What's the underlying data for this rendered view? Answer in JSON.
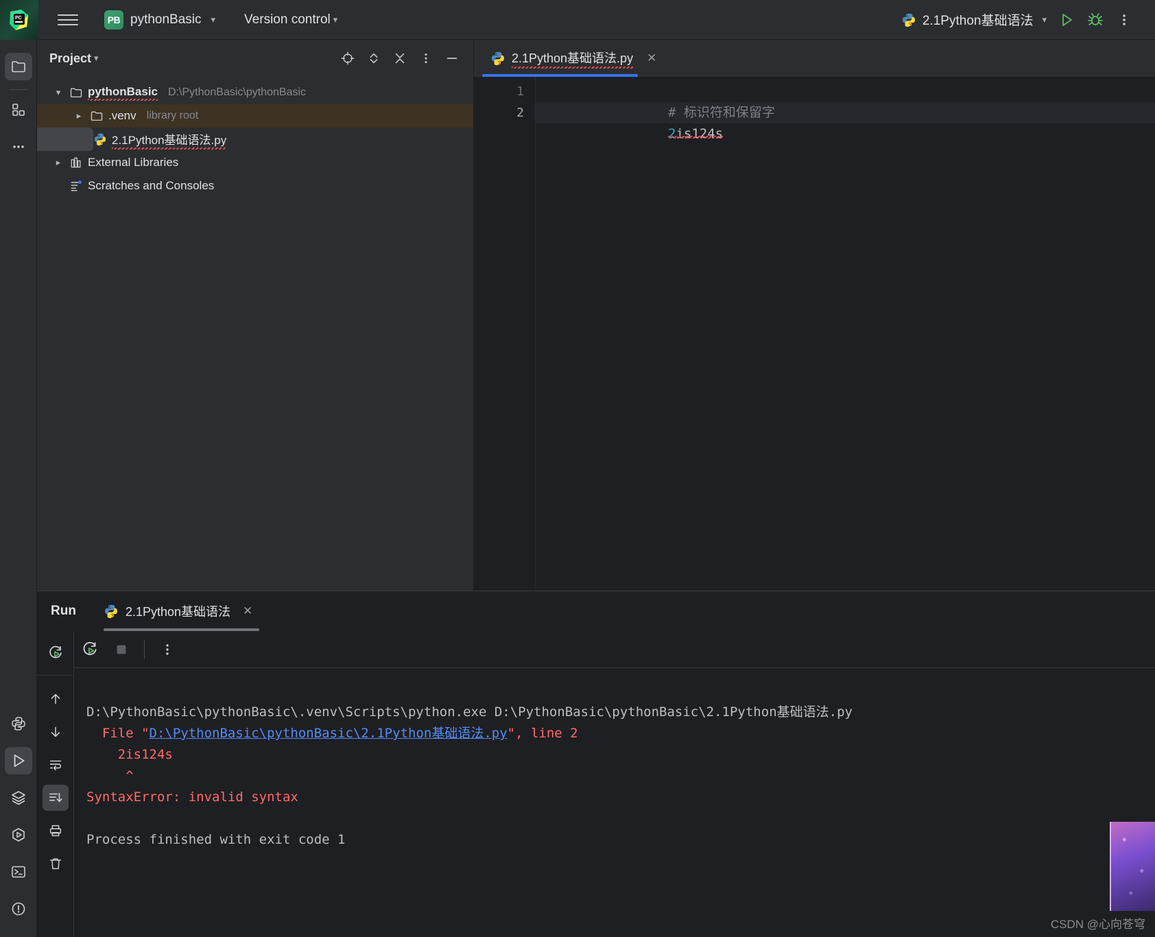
{
  "titlebar": {
    "app_logo": "pycharm-logo-icon",
    "menu_icon": "hamburger-menu-icon",
    "project_badge": "PB",
    "project_name": "pythonBasic",
    "vcs_label": "Version control",
    "run_config_name": "2.1Python基础语法",
    "run_icon": "run-icon",
    "debug_icon": "debug-icon",
    "more_icon": "more-vertical-icon"
  },
  "left_stripe": {
    "top": [
      {
        "name": "project-tool-window",
        "icon": "folder-icon",
        "active": true
      },
      {
        "name": "structure-tool-window",
        "icon": "structure-grid-icon",
        "active": false
      },
      {
        "name": "more-tool-windows",
        "icon": "ellipsis-icon",
        "active": false
      }
    ],
    "bottom": [
      {
        "name": "python-console",
        "icon": "python-icon",
        "active": false
      },
      {
        "name": "run-tool-window",
        "icon": "run-triangle-icon",
        "active": true
      },
      {
        "name": "services-tool-window",
        "icon": "layers-icon",
        "active": false
      },
      {
        "name": "python-packages",
        "icon": "hexagon-play-icon",
        "active": false
      },
      {
        "name": "terminal-tool-window",
        "icon": "terminal-icon",
        "active": false
      },
      {
        "name": "problems-tool-window",
        "icon": "warning-circle-icon",
        "active": false
      }
    ]
  },
  "project_panel": {
    "title": "Project",
    "title_caret": "chevron-down-icon",
    "header_icons": [
      {
        "name": "select-opened-file-button",
        "icon": "target-icon"
      },
      {
        "name": "expand-collapse-button",
        "icon": "chevron-updown-icon"
      },
      {
        "name": "close-all-button",
        "icon": "collapse-x-icon"
      },
      {
        "name": "options-button",
        "icon": "more-vertical-icon"
      },
      {
        "name": "hide-button",
        "icon": "minimize-icon"
      }
    ],
    "tree": [
      {
        "name": "tree-node-project-root",
        "label": "pythonBasic",
        "secondary": "D:\\PythonBasic\\pythonBasic",
        "arrow": "chevron-down-icon",
        "icon": "folder-icon",
        "indent": 1,
        "bold": true,
        "spellcheck_underline": true,
        "state": "normal"
      },
      {
        "name": "tree-node-venv",
        "label": ".venv",
        "secondary": "library root",
        "arrow": "chevron-right-icon",
        "icon": "folder-icon",
        "indent": 2,
        "bold": false,
        "spellcheck_underline": false,
        "state": "highlighted"
      },
      {
        "name": "tree-node-python-file",
        "label": "2.1Python基础语法.py",
        "secondary": "",
        "arrow": "",
        "icon": "python-file-icon",
        "indent": 3,
        "bold": false,
        "spellcheck_underline": true,
        "state": "selected"
      },
      {
        "name": "tree-node-external-libraries",
        "label": "External Libraries",
        "secondary": "",
        "arrow": "chevron-right-icon",
        "icon": "library-icon",
        "indent": 1,
        "bold": false,
        "spellcheck_underline": false,
        "state": "normal"
      },
      {
        "name": "tree-node-scratches",
        "label": "Scratches and Consoles",
        "secondary": "",
        "arrow": "",
        "icon": "scratches-icon",
        "indent": 1,
        "bold": false,
        "spellcheck_underline": false,
        "state": "normal"
      }
    ]
  },
  "editor": {
    "tab": {
      "label": "2.1Python基础语法.py",
      "icon": "python-file-icon",
      "close_icon": "close-icon",
      "active": true
    },
    "lines": [
      {
        "number": "1",
        "current": false,
        "tokens": [
          {
            "text": "# ",
            "kind": "comment"
          },
          {
            "text": "标识符和保留字",
            "kind": "comment"
          }
        ]
      },
      {
        "number": "2",
        "current": true,
        "tokens": [
          {
            "text": "2",
            "kind": "number"
          },
          {
            "text": "is124s",
            "kind": "plain-error"
          }
        ]
      }
    ]
  },
  "run_panel": {
    "title": "Run",
    "tab": {
      "label": "2.1Python基础语法",
      "icon": "python-icon",
      "close_icon": "close-icon",
      "active": true
    },
    "toolbar": [
      {
        "name": "rerun-button",
        "icon": "rerun-icon"
      },
      {
        "name": "stop-button",
        "icon": "stop-square-icon"
      },
      {
        "name": "more-options-button",
        "icon": "more-vertical-icon"
      }
    ],
    "side_buttons": [
      {
        "name": "rerun-side-button",
        "icon": "rerun-icon",
        "active": false
      },
      {
        "name": "up-the-stack-trace-button",
        "icon": "arrow-up-icon",
        "active": false
      },
      {
        "name": "down-the-stack-trace-button",
        "icon": "arrow-down-icon",
        "active": false
      },
      {
        "name": "soft-wrap-button",
        "icon": "soft-wrap-icon",
        "active": false
      },
      {
        "name": "scroll-to-end-button",
        "icon": "scroll-to-end-icon",
        "active": true
      },
      {
        "name": "print-button",
        "icon": "printer-icon",
        "active": false
      },
      {
        "name": "clear-all-button",
        "icon": "trash-icon",
        "active": false
      }
    ],
    "console_lines": [
      {
        "name": "console-line-command",
        "segments": [
          {
            "text": "D:\\PythonBasic\\pythonBasic\\.venv\\Scripts\\python.exe D:\\PythonBasic\\pythonBasic\\2.1Python基础语法.py",
            "kind": "white"
          }
        ]
      },
      {
        "name": "console-line-file",
        "segments": [
          {
            "text": "  File \"",
            "kind": "red"
          },
          {
            "text": "D:\\PythonBasic\\pythonBasic\\2.1Python基础语法.py",
            "kind": "link"
          },
          {
            "text": "\", line 2",
            "kind": "red"
          }
        ]
      },
      {
        "name": "console-line-source",
        "segments": [
          {
            "text": "    2is124s",
            "kind": "red"
          }
        ]
      },
      {
        "name": "console-line-caret",
        "segments": [
          {
            "text": "     ^",
            "kind": "red"
          }
        ]
      },
      {
        "name": "console-line-error",
        "segments": [
          {
            "text": "SyntaxError: invalid syntax",
            "kind": "red"
          }
        ]
      },
      {
        "name": "console-line-blank",
        "segments": [
          {
            "text": " ",
            "kind": "white"
          }
        ]
      },
      {
        "name": "console-line-exit",
        "segments": [
          {
            "text": "Process finished with exit code 1",
            "kind": "white"
          }
        ]
      }
    ]
  },
  "watermark": {
    "text": "CSDN @心向苍穹"
  },
  "colors": {
    "accent_blue": "#3574f0",
    "link_blue": "#548af7",
    "error_red": "#ff6b68",
    "number_teal": "#2aacb8",
    "comment_gray": "#7a7e85",
    "panel_bg": "#2b2d30",
    "editor_bg": "#1e1f22",
    "selection_bg": "#43454a",
    "venv_highlight": "#3d3223"
  }
}
